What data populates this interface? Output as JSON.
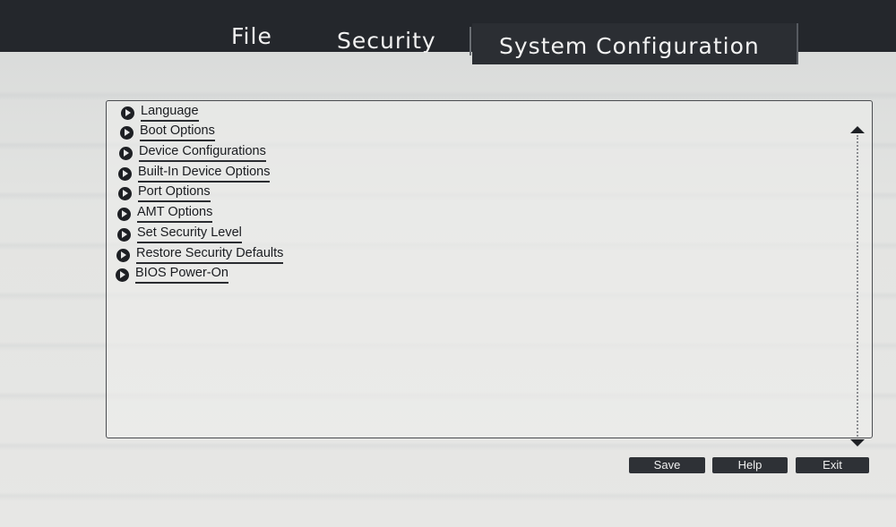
{
  "tabs": {
    "file": "File",
    "security": "Security",
    "system_configuration": "System Configuration"
  },
  "active_tab": "System Configuration",
  "menu_items": [
    {
      "label": "Language"
    },
    {
      "label": "Boot Options"
    },
    {
      "label": "Device Configurations"
    },
    {
      "label": "Built-In Device Options"
    },
    {
      "label": "Port Options"
    },
    {
      "label": "AMT Options"
    },
    {
      "label": "Set Security Level"
    },
    {
      "label": "Restore Security Defaults"
    },
    {
      "label": "BIOS Power-On"
    }
  ],
  "buttons": {
    "save": "Save",
    "help": "Help",
    "exit": "Exit"
  },
  "icons": {
    "menu_bullet": "play-circle-icon",
    "scroll_up": "triangle-up-icon",
    "scroll_down": "triangle-down-icon"
  }
}
